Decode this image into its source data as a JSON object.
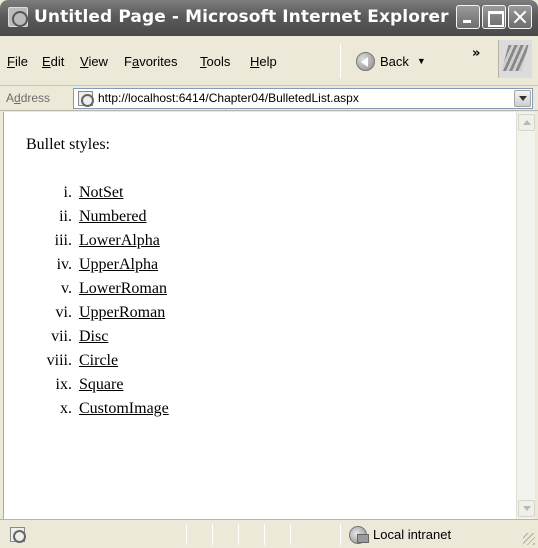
{
  "window": {
    "title": "Untitled Page - Microsoft Internet Explorer"
  },
  "menubar": {
    "items": [
      {
        "pre": "",
        "u": "F",
        "post": "ile"
      },
      {
        "pre": "",
        "u": "E",
        "post": "dit"
      },
      {
        "pre": "",
        "u": "V",
        "post": "iew"
      },
      {
        "pre": "F",
        "u": "a",
        "post": "vorites"
      },
      {
        "pre": "",
        "u": "T",
        "post": "ools"
      },
      {
        "pre": "",
        "u": "H",
        "post": "elp"
      }
    ],
    "back_label": "Back",
    "more": "»"
  },
  "address": {
    "label_pre": "A",
    "label_u": "d",
    "label_post": "dress",
    "url": "http://localhost:6414/Chapter04/BulletedList.aspx"
  },
  "content": {
    "heading": "Bullet styles:",
    "items": [
      {
        "num": "i.",
        "label": "NotSet"
      },
      {
        "num": "ii.",
        "label": "Numbered"
      },
      {
        "num": "iii.",
        "label": "LowerAlpha"
      },
      {
        "num": "iv.",
        "label": "UpperAlpha"
      },
      {
        "num": "v.",
        "label": "LowerRoman"
      },
      {
        "num": "vi.",
        "label": "UpperRoman"
      },
      {
        "num": "vii.",
        "label": "Disc"
      },
      {
        "num": "viii.",
        "label": "Circle"
      },
      {
        "num": "ix.",
        "label": "Square"
      },
      {
        "num": "x.",
        "label": "CustomImage"
      }
    ]
  },
  "status": {
    "zone": "Local intranet"
  },
  "icons": {
    "title": "ie-page-icon",
    "back": "back-arrow-icon",
    "logo": "windows-logo-icon",
    "address_page": "page-icon",
    "status_page": "page-icon",
    "zone": "local-intranet-icon"
  }
}
